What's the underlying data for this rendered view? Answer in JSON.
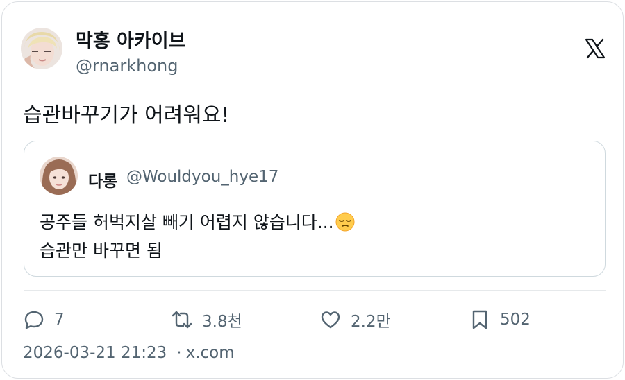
{
  "author": {
    "display_name": "막홍 아카이브",
    "handle": "@rnarkhong"
  },
  "tweet": {
    "text": "습관바꾸기가 어려워요!"
  },
  "quoted": {
    "display_name": "다롱",
    "handle": "@Wouldyou_hye17",
    "line1": "공주들 허벅지살 빼기 어렵지 않습니다...",
    "emoji": "pensive-face-emoji",
    "line2": "습관만 바꾸면 됨"
  },
  "actions": {
    "replies": "7",
    "reposts": "3.8천",
    "likes": "2.2만",
    "bookmarks": "502"
  },
  "meta": {
    "timestamp": "2026-03-21 21:23",
    "separator": "·",
    "source": "x.com"
  },
  "icons": [
    "x-logo-icon",
    "reply-icon",
    "repost-icon",
    "like-icon",
    "bookmark-icon"
  ],
  "colors": {
    "text": "#0f1419",
    "secondary": "#536471",
    "border": "#cfd9de"
  }
}
